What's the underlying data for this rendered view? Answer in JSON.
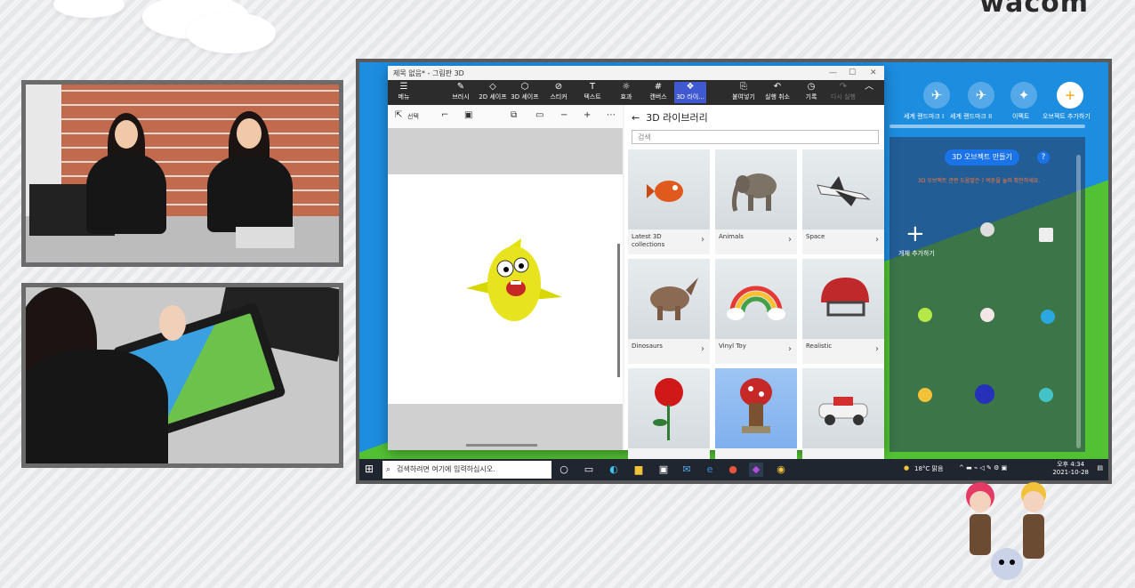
{
  "brand": {
    "logo": "wacom"
  },
  "window": {
    "title": "제목 없음* - 그림판 3D",
    "controls": [
      "—",
      "☐",
      "✕"
    ]
  },
  "ribbon": {
    "items": [
      {
        "label": "메뉴",
        "icon": "menu-icon"
      },
      {
        "label": "브러시",
        "icon": "brush-icon"
      },
      {
        "label": "2D 셰이프",
        "icon": "2d-shapes-icon"
      },
      {
        "label": "3D 셰이프",
        "icon": "3d-shapes-icon"
      },
      {
        "label": "스티커",
        "icon": "sticker-icon"
      },
      {
        "label": "텍스트",
        "icon": "text-icon"
      },
      {
        "label": "효과",
        "icon": "effects-icon"
      },
      {
        "label": "캔버스",
        "icon": "canvas-icon"
      },
      {
        "label": "3D 라이...",
        "icon": "3d-library-icon"
      },
      {
        "label": "붙여넣기",
        "icon": "paste-icon"
      },
      {
        "label": "실행 취소",
        "icon": "undo-icon"
      },
      {
        "label": "기록",
        "icon": "history-icon"
      },
      {
        "label": "다시 실행",
        "icon": "redo-icon"
      }
    ]
  },
  "canvas_tools": {
    "select_label": "선택"
  },
  "library": {
    "title": "3D 라이브러리",
    "search_placeholder": "검색",
    "tiles": [
      {
        "label": "Latest 3D collections",
        "icon": "fish-icon"
      },
      {
        "label": "Animals",
        "icon": "elephant-icon"
      },
      {
        "label": "Space",
        "icon": "space-shuttle-icon"
      },
      {
        "label": "Dinosaurs",
        "icon": "dinosaur-icon"
      },
      {
        "label": "Vinyl Toy",
        "icon": "rainbow-icon"
      },
      {
        "label": "Realistic",
        "icon": "helmet-icon"
      },
      {
        "label": "",
        "icon": "rose-icon"
      },
      {
        "label": "",
        "icon": "mushroom-house-icon"
      },
      {
        "label": "",
        "icon": "car-icon"
      }
    ]
  },
  "side_panel": {
    "icons": [
      {
        "label": "세계 랜드마크 I",
        "icon": "jet-icon"
      },
      {
        "label": "세계 랜드마크 II",
        "icon": "jet-icon"
      },
      {
        "label": "이펙트",
        "icon": "wand-icon"
      },
      {
        "label": "오브젝트 추가하기",
        "icon": "plus-icon"
      }
    ],
    "make_button": "3D 오브젝트 만들기",
    "note": "3D 오브젝트 관련 도움말은 ? 버튼을 눌러 확인하세요.",
    "add_label": "개체 추가하기"
  },
  "taskbar": {
    "search_placeholder": "검색하려면 여기에 입력하십시오.",
    "weather": "18°C 맑음",
    "time": "오후 4:34",
    "date": "2021-10-28"
  },
  "colors": {
    "ribbon_bg": "#2c2c2c",
    "accent": "#3f5ad0",
    "wallpaper_blue": "#1d8de0",
    "wallpaper_green": "#52c234"
  }
}
